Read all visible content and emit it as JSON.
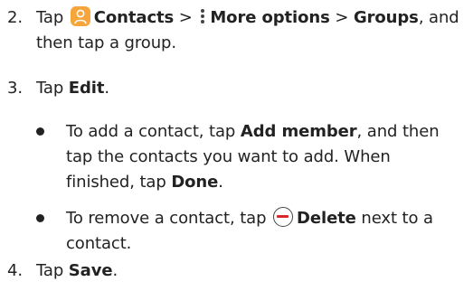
{
  "steps": [
    {
      "number": "2.",
      "line1": {
        "tap": "Tap",
        "contacts": "Contacts",
        "sep1": ">",
        "more": "More options",
        "sep2": ">",
        "groups": "Groups",
        "tail": ", and"
      },
      "line2": "then tap a group."
    },
    {
      "number": "3.",
      "tap": "Tap",
      "edit": "Edit",
      "period": "."
    },
    {
      "number": "4.",
      "tap": "Tap",
      "save": "Save",
      "period": "."
    }
  ],
  "bullets": [
    {
      "pre": "To add a contact, tap",
      "add_member": "Add member",
      "mid": ", and then tap the contacts you want to add. When finished, tap",
      "done": "Done",
      "period": "."
    },
    {
      "pre": "To remove a contact, tap",
      "delete": "Delete",
      "post": "next to a contact."
    }
  ],
  "icons": {
    "contacts": "contacts-app-icon",
    "more_options": "vertical-dots-icon",
    "delete": "minus-circle-icon"
  },
  "colors": {
    "contacts_icon": "#f6a53a",
    "delete_minus": "#d8262b",
    "text": "#222222"
  }
}
